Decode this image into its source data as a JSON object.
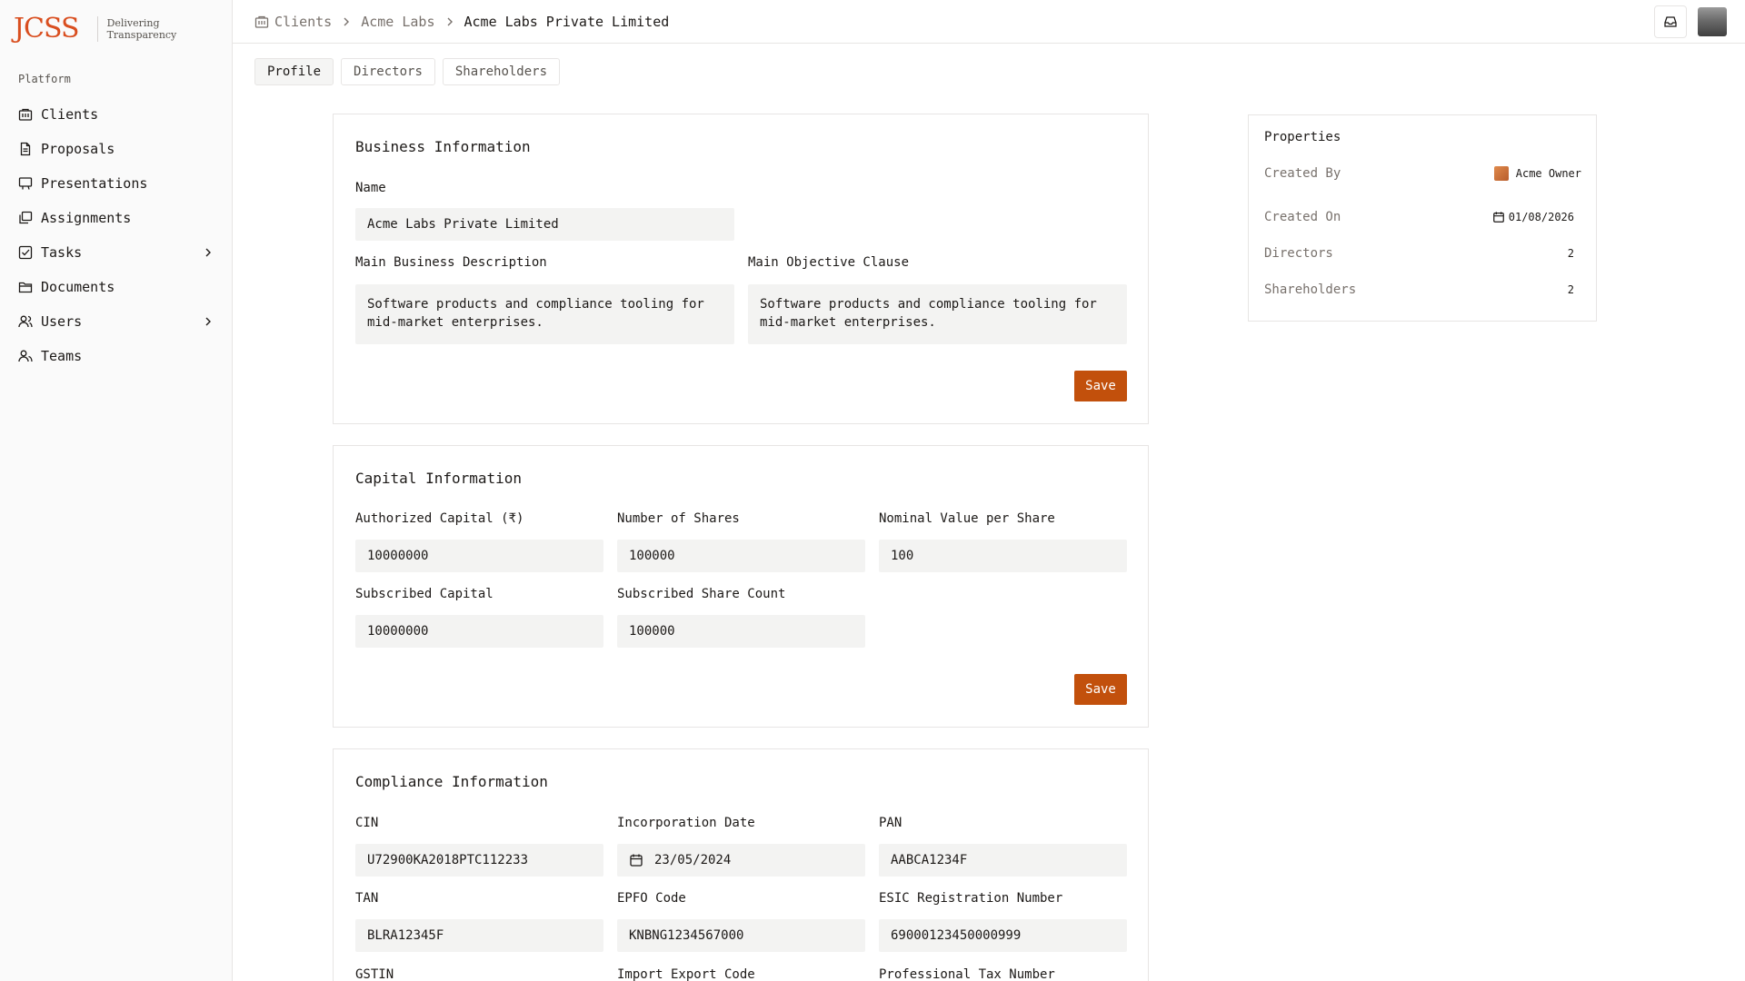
{
  "brand": {
    "logo": "JCSS",
    "tagline": "Delivering Transparency"
  },
  "sidebar": {
    "section_label": "Platform",
    "items": [
      {
        "label": "Clients",
        "icon": "building-icon"
      },
      {
        "label": "Proposals",
        "icon": "document-icon"
      },
      {
        "label": "Presentations",
        "icon": "presentation-icon"
      },
      {
        "label": "Assignments",
        "icon": "layers-icon"
      },
      {
        "label": "Tasks",
        "icon": "checkbox-icon"
      },
      {
        "label": "Documents",
        "icon": "folder-icon"
      },
      {
        "label": "Users",
        "icon": "users-icon"
      },
      {
        "label": "Teams",
        "icon": "team-icon"
      }
    ]
  },
  "breadcrumb": {
    "items": [
      "Clients",
      "Acme Labs"
    ],
    "current": "Acme Labs Private Limited"
  },
  "tabs": [
    "Profile",
    "Directors",
    "Shareholders"
  ],
  "business": {
    "title": "Business Information",
    "name_label": "Name",
    "name_value": "Acme Labs Private Limited",
    "desc_label": "Main Business Description",
    "desc_value": "Software products and compliance tooling for mid-market enterprises.",
    "objective_label": "Main Objective Clause",
    "objective_value": "Software products and compliance tooling for mid-market enterprises.",
    "save": "Save"
  },
  "capital": {
    "title": "Capital Information",
    "authorized_label": "Authorized Capital (₹)",
    "authorized_value": "10000000",
    "shares_label": "Number of Shares",
    "shares_value": "100000",
    "nominal_label": "Nominal Value per Share",
    "nominal_value": "100",
    "subscribed_label": "Subscribed Capital",
    "subscribed_value": "10000000",
    "subscribed_count_label": "Subscribed Share Count",
    "subscribed_count_value": "100000",
    "save": "Save"
  },
  "compliance": {
    "title": "Compliance Information",
    "cin_label": "CIN",
    "cin_value": "U72900KA2018PTC112233",
    "incorp_label": "Incorporation Date",
    "incorp_value": "23/05/2024",
    "pan_label": "PAN",
    "pan_value": "AABCA1234F",
    "tan_label": "TAN",
    "tan_value": "BLRA12345F",
    "epfo_label": "EPFO Code",
    "epfo_value": "KNBNG1234567000",
    "esic_label": "ESIC Registration Number",
    "esic_value": "69000123450000999",
    "gstin_label": "GSTIN",
    "iec_label": "Import Export Code",
    "ptax_label": "Professional Tax Number"
  },
  "properties": {
    "title": "Properties",
    "created_by_label": "Created By",
    "created_by_value": "Acme Owner",
    "created_on_label": "Created On",
    "created_on_value": "01/08/2026",
    "directors_label": "Directors",
    "directors_value": "2",
    "shareholders_label": "Shareholders",
    "shareholders_value": "2"
  },
  "colors": {
    "accent": "#c2500c",
    "brand": "#d94e1f"
  }
}
